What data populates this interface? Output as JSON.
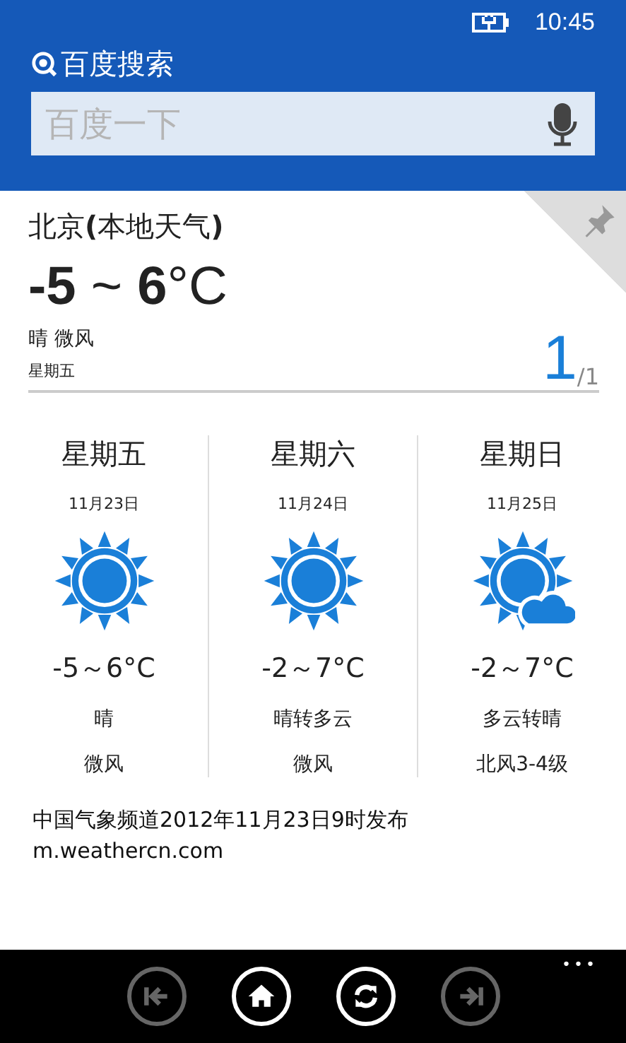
{
  "status_bar": {
    "time": "10:45"
  },
  "header": {
    "title": "百度搜索",
    "search": {
      "placeholder": "百度一下"
    }
  },
  "current": {
    "city": "北京**(**本地天气**)**",
    "pinned": true,
    "temperature": "**-5** ~ **6**°C",
    "condition": "晴 微风",
    "day": "星期五",
    "page": "1",
    "page_total": "/1"
  },
  "forecast": [
    {
      "day": "星期五",
      "date": "11月23日",
      "kind": "sunny",
      "temp": "-5～6°C",
      "weather": "晴",
      "wind": "微风"
    },
    {
      "day": "星期六",
      "date": "11月24日",
      "kind": "sunny",
      "temp": "-2～7°C",
      "weather": "晴转多云",
      "wind": "微风"
    },
    {
      "day": "星期日",
      "date": "11月25日",
      "kind": "partly-cloudy",
      "temp": "-2～7°C",
      "weather": "多云转晴",
      "wind": "北风3-4级"
    }
  ],
  "source": {
    "text": "中国气象频道2012年11月23日9时发布",
    "url": "m.weathercn.com"
  },
  "app_bar": {
    "buttons": [
      {
        "kind": "first",
        "disabled": true
      },
      {
        "kind": "home",
        "disabled": false
      },
      {
        "kind": "refresh",
        "disabled": false
      },
      {
        "kind": "last",
        "disabled": true
      }
    ],
    "more": "•••"
  }
}
